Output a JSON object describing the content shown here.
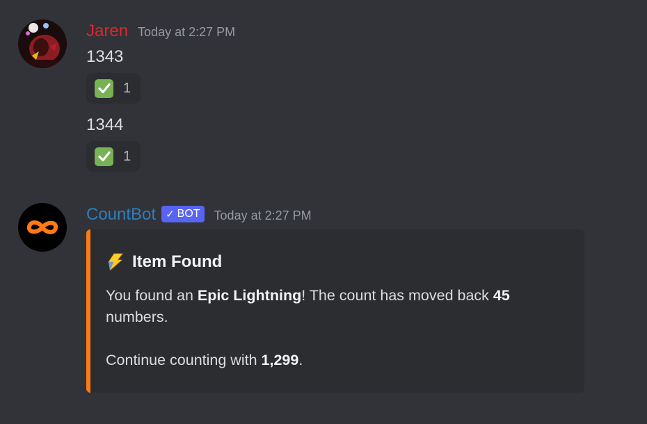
{
  "colors": {
    "background": "#313338",
    "embed_background": "#2b2d31",
    "embed_accent": "#fe7a13",
    "user_name_color": "#e3242b",
    "bot_name_color": "#2e7dbf",
    "bot_tag_color": "#5865f2",
    "reaction_emoji_color": "#77b255"
  },
  "messages": [
    {
      "author": "Jaren",
      "avatar_icon": "user-avatar",
      "timestamp": "Today at 2:27 PM",
      "lines": [
        {
          "text": "1343",
          "reaction": {
            "emoji": "white-check-mark-icon",
            "count": "1"
          }
        },
        {
          "text": "1344",
          "reaction": {
            "emoji": "white-check-mark-icon",
            "count": "1"
          }
        }
      ]
    },
    {
      "author": "CountBot",
      "avatar_icon": "infinity-icon",
      "bot_tag": "BOT",
      "timestamp": "Today at 2:27 PM",
      "embed": {
        "title_icon": "lightning-icon",
        "title": "Item Found",
        "line1_prefix": "You found an ",
        "line1_item": "Epic Lightning",
        "line1_mid": "! The count has moved back ",
        "line1_amount": "45",
        "line1_suffix": " numbers.",
        "line2_prefix": "Continue counting with ",
        "line2_number": "1,299",
        "line2_suffix": "."
      }
    }
  ]
}
